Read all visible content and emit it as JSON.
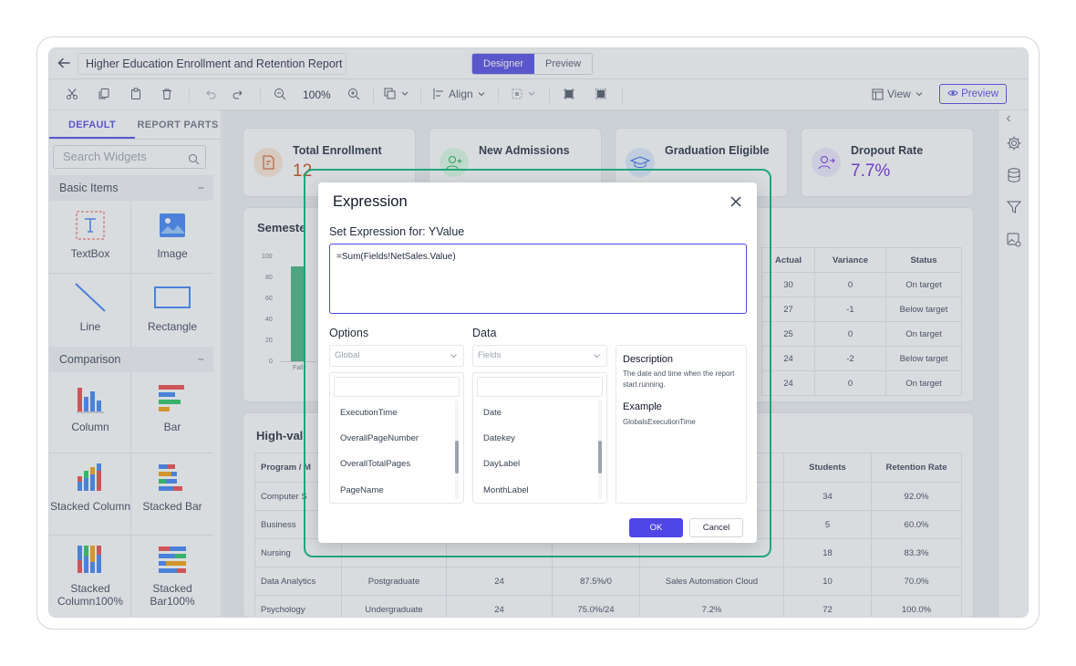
{
  "header": {
    "report_title": "Higher Education Enrollment and Retention Report",
    "modes": [
      "Designer",
      "Preview"
    ],
    "active_mode": "Designer"
  },
  "toolbar": {
    "zoom": "100%",
    "align_label": "Align",
    "view_label": "View",
    "preview_label": "Preview"
  },
  "left_panel": {
    "tabs": [
      "DEFAULT",
      "REPORT PARTS"
    ],
    "search_placeholder": "Search Widgets",
    "sections": [
      {
        "title": "Basic Items",
        "toggle": "−"
      },
      {
        "title": "Comparison",
        "toggle": "−"
      }
    ],
    "basic_items": [
      "TextBox",
      "Image",
      "Line",
      "Rectangle"
    ],
    "comparison_items": [
      "Column",
      "Bar",
      "Stacked Column",
      "Stacked Bar",
      "Stacked Column100%",
      "Stacked Bar100%"
    ]
  },
  "canvas": {
    "kpis": [
      {
        "label": "Total Enrollment",
        "value": "12"
      },
      {
        "label": "New Admissions",
        "value": ""
      },
      {
        "label": "Graduation Eligible",
        "value": ""
      },
      {
        "label": "Dropout Rate",
        "value": "7.7%"
      }
    ],
    "semester_title": "Semeste",
    "chart_axis": [
      "100",
      "80",
      "60",
      "40",
      "20",
      "0"
    ],
    "chart_x": "Fall",
    "target_table": {
      "headers": [
        "Actual",
        "Variance",
        "Status"
      ],
      "rows": [
        [
          "30",
          "0",
          "On target"
        ],
        [
          "27",
          "-1",
          "Below target"
        ],
        [
          "25",
          "0",
          "On target"
        ],
        [
          "24",
          "-2",
          "Below target"
        ],
        [
          "24",
          "0",
          "On target"
        ]
      ]
    },
    "program_title": "High-val",
    "program_table": {
      "headers": [
        "Program / M",
        "",
        "",
        "",
        "",
        "Students",
        "Retention Rate"
      ],
      "rows": [
        [
          "Computer S",
          "",
          "",
          "",
          "",
          "34",
          "92.0%"
        ],
        [
          "Business",
          "",
          "",
          "",
          "",
          "5",
          "60.0%"
        ],
        [
          "Nursing",
          "",
          "",
          "",
          "",
          "18",
          "83.3%"
        ],
        [
          "Data Analytics",
          "Postgraduate",
          "24",
          "87.5%/0",
          "Sales Automation Cloud",
          "10",
          "70.0%"
        ],
        [
          "Psychology",
          "Undergraduate",
          "24",
          "75.0%/24",
          "7.2%",
          "72",
          "100.0%"
        ]
      ]
    }
  },
  "dialog": {
    "title": "Expression",
    "subtitle": "Set Expression for: YValue",
    "expression": "=Sum(Fields!NetSales.Value)",
    "options_label": "Options",
    "options_selected": "Global",
    "options_items": [
      "ExecutionTime",
      "OverallPageNumber",
      "OverallTotalPages",
      "PageName"
    ],
    "data_label": "Data",
    "data_selected": "Fields",
    "data_items": [
      "Date",
      "Datekey",
      "DayLabel",
      "MonthLabel"
    ],
    "description_heading": "Description",
    "description_text": "The date and time when the report start running.",
    "example_heading": "Example",
    "example_text": "GlobalsExecutionTime",
    "ok_label": "OK",
    "cancel_label": "Cancel"
  },
  "colors": {
    "accent": "#4f46e5",
    "highlight": "#22a67a"
  }
}
